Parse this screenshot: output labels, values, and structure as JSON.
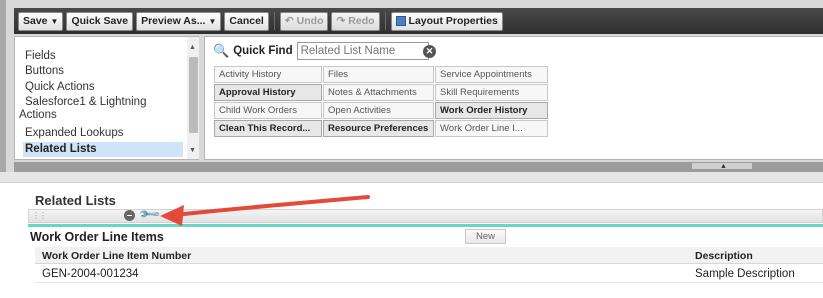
{
  "toolbar": {
    "save_label": "Save",
    "quick_save_label": "Quick Save",
    "preview_as_label": "Preview As...",
    "cancel_label": "Cancel",
    "undo_label": "Undo",
    "redo_label": "Redo",
    "layout_properties_label": "Layout Properties"
  },
  "sidebar": {
    "items": [
      {
        "label": "Fields"
      },
      {
        "label": "Buttons"
      },
      {
        "label": "Quick Actions"
      },
      {
        "label": "Salesforce1 & Lightning"
      },
      {
        "label": "Actions"
      },
      {
        "label": "Expanded Lookups"
      },
      {
        "label": "Related Lists",
        "selected": true
      }
    ]
  },
  "quick_find": {
    "label": "Quick Find",
    "placeholder": "Related List Name"
  },
  "palette": {
    "items": [
      {
        "label": "Activity History",
        "used": false
      },
      {
        "label": "Files",
        "used": false
      },
      {
        "label": "Service Appointments",
        "used": false
      },
      {
        "label": "Approval History",
        "used": true
      },
      {
        "label": "Notes & Attachments",
        "used": false
      },
      {
        "label": "Skill Requirements",
        "used": false
      },
      {
        "label": "Child Work Orders",
        "used": false
      },
      {
        "label": "Open Activities",
        "used": false
      },
      {
        "label": "Work Order History",
        "used": true
      },
      {
        "label": "Clean This Record...",
        "used": true
      },
      {
        "label": "Resource Preferences",
        "used": true
      },
      {
        "label": "Work Order Line I...",
        "used": false
      }
    ]
  },
  "related_lists_section": {
    "title": "Related Lists",
    "list_name": "Work Order Line Items",
    "new_button_label": "New",
    "columns": [
      "Work Order Line Item Number",
      "Description"
    ],
    "rows": [
      [
        "GEN-2004-001234",
        "Sample Description"
      ]
    ]
  },
  "colors": {
    "toolbar_bg": "#3a3a3a",
    "selected_item": "#cfe4f6",
    "accent_teal": "#66d7c7",
    "annotation_arrow": "#e34a3c"
  },
  "icons": [
    "dropdown-caret-icon",
    "undo-icon",
    "redo-icon",
    "layout-properties-icon",
    "search-icon",
    "clear-icon",
    "remove-icon",
    "wrench-icon",
    "grip-icon"
  ]
}
